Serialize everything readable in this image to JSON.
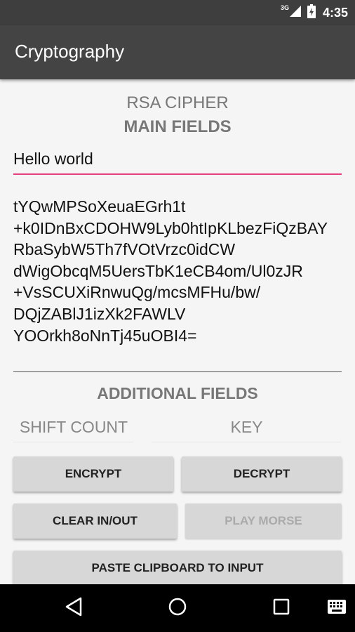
{
  "status_bar": {
    "network": "3G",
    "time": "4:35"
  },
  "app": {
    "title": "Cryptography"
  },
  "main": {
    "cipher_heading": "RSA CIPHER",
    "main_fields_heading": "MAIN FIELDS",
    "input_value": "Hello world",
    "output_lines": [
      "tYQwMPSoXeuaEGrh1t",
      "+k0IDnBxCDOHW9Lyb0htIpKLbezFiQzBAY",
      "RbaSybW5Th7fVOtVrzc0idCW",
      "dWigObcqM5UersTbK1eCB4om/Ul0zJR",
      "+VsSCUXiRnwuQg/mcsMFHu/bw/",
      "DQjZABlJ1izXk2FAWLV",
      "YOOrkh8oNnTj45uOBI4="
    ],
    "additional_fields_heading": "ADDITIONAL FIELDS",
    "shift_count_placeholder": "SHIFT COUNT",
    "key_placeholder": "KEY"
  },
  "buttons": {
    "encrypt": "ENCRYPT",
    "decrypt": "DECRYPT",
    "clear": "CLEAR IN/OUT",
    "play_morse": "PLAY MORSE",
    "paste": "PASTE CLIPBOARD TO INPUT"
  },
  "colors": {
    "accent": "#e4407e",
    "toolbar": "#444444",
    "status_bar": "#3e3e3e",
    "background": "#f5f5f5",
    "button": "#d7d7d7"
  },
  "icons": {
    "signal": "signal-icon",
    "battery": "battery-charging-icon",
    "back": "back-icon",
    "home": "home-icon",
    "recents": "recents-icon",
    "keyboard": "keyboard-icon"
  }
}
